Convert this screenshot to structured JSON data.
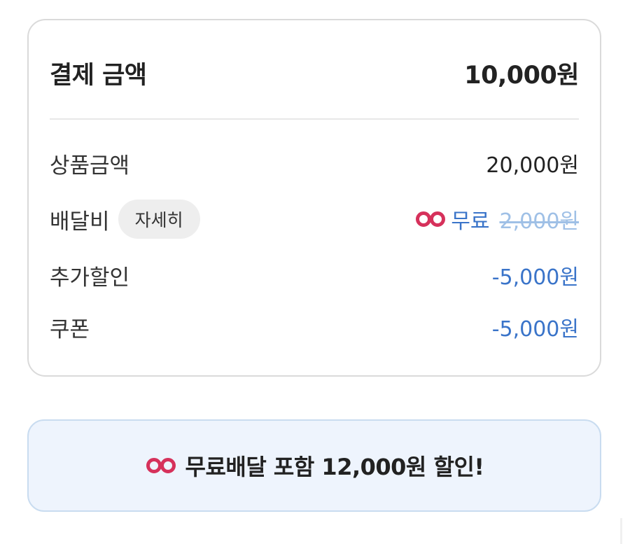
{
  "summary": {
    "total_label": "결제 금액",
    "total_value": "10,000원",
    "rows": [
      {
        "label": "상품금액",
        "value": "20,000원"
      },
      {
        "label": "배달비",
        "detail_button": "자세히",
        "free_label": "무료",
        "original_value": "2,000원"
      },
      {
        "label": "추가할인",
        "value": "-5,000원"
      },
      {
        "label": "쿠폰",
        "value": "-5,000원"
      }
    ]
  },
  "banner": {
    "text": "무료배달 포함 12,000원 할인!"
  },
  "icons": {
    "pass": "delivery-pass-icon"
  },
  "colors": {
    "discount_blue": "#3a74c9",
    "strike_blue": "#9fc0e6",
    "pass_red": "#d6315b",
    "banner_bg": "#eef4fd"
  }
}
